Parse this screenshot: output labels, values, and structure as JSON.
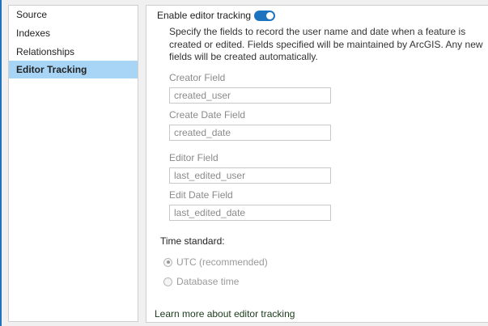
{
  "sidebar": {
    "items": [
      {
        "label": "Source"
      },
      {
        "label": "Indexes"
      },
      {
        "label": "Relationships"
      },
      {
        "label": "Editor Tracking",
        "selected": true
      }
    ]
  },
  "main": {
    "enable_label": "Enable editor tracking",
    "enable_on": true,
    "description": "Specify the fields to record the user name and date when a feature is created or edited. Fields specified will be maintained by ArcGIS. Any new fields will be created automatically.",
    "fields": [
      {
        "label": "Creator Field",
        "value": "created_user"
      },
      {
        "label": "Create Date Field",
        "value": "created_date"
      },
      {
        "label": "Editor Field",
        "value": "last_edited_user"
      },
      {
        "label": "Edit Date Field",
        "value": "last_edited_date"
      }
    ],
    "time_standard_label": "Time standard:",
    "time_options": [
      {
        "label": "UTC (recommended)",
        "selected": true
      },
      {
        "label": "Database time",
        "selected": false
      }
    ],
    "learn_more": "Learn more about editor tracking"
  },
  "colors": {
    "accent": "#1e73be",
    "selected": "#a8d5f5"
  }
}
